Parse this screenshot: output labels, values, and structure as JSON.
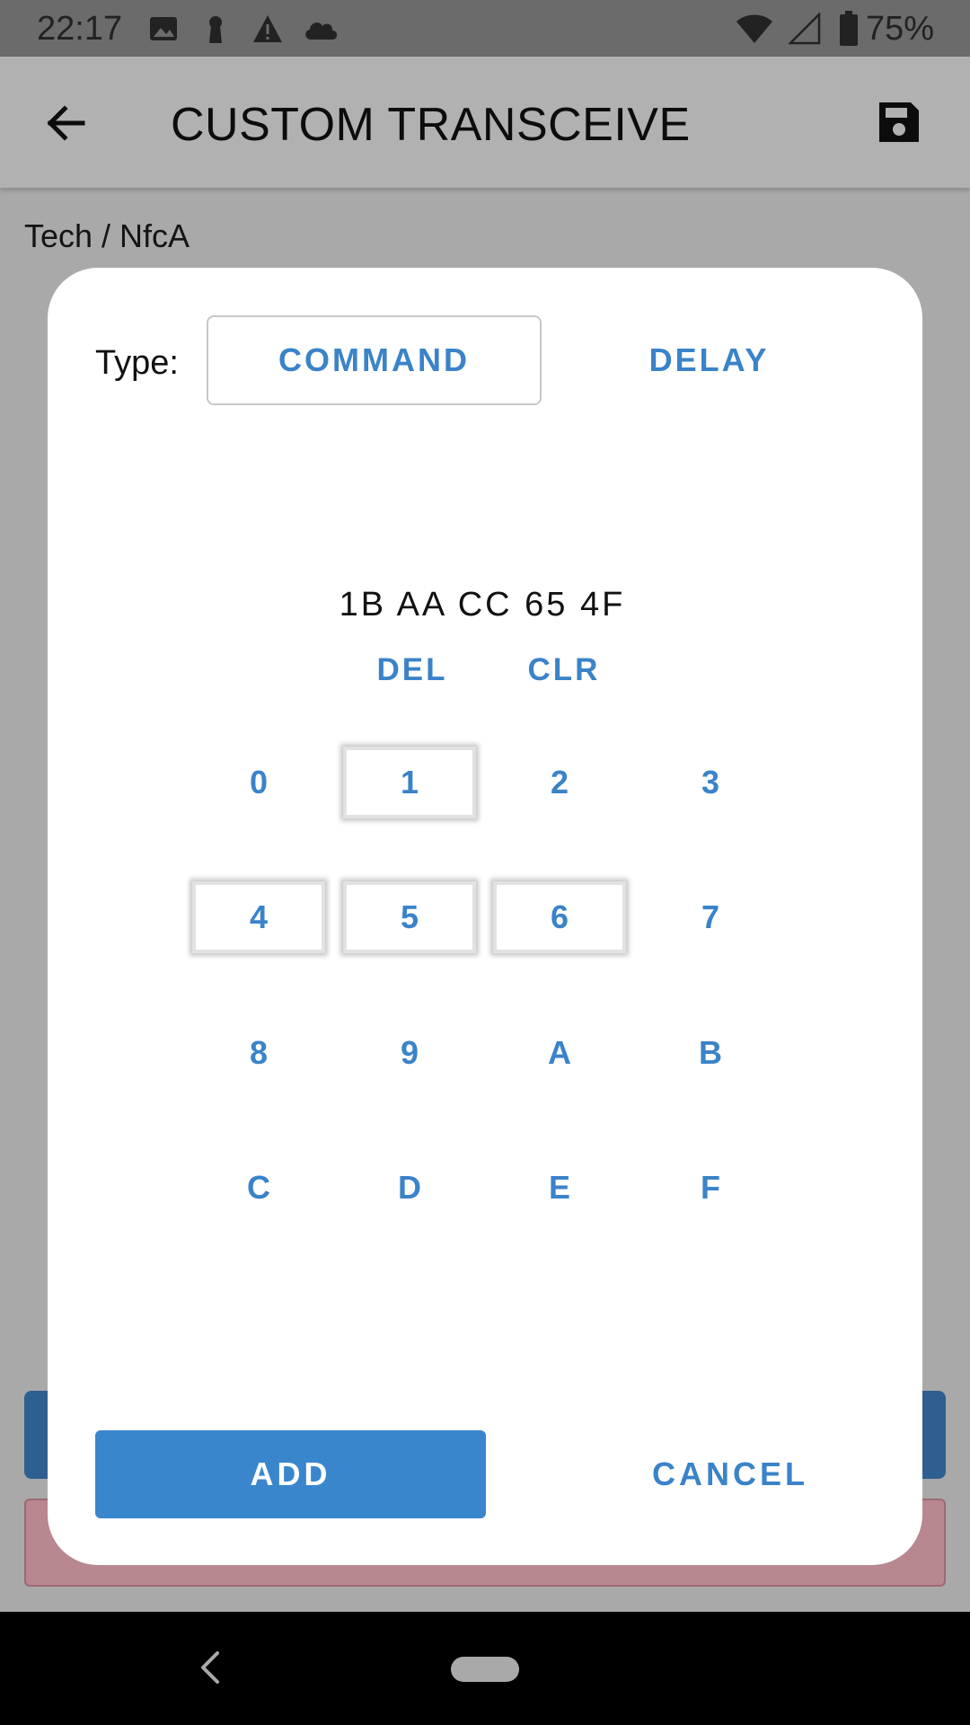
{
  "status_bar": {
    "time": "22:17",
    "battery_percent": "75%",
    "icons": [
      "image-icon",
      "keyhole-icon",
      "warning-icon",
      "cloud-icon",
      "wifi-icon",
      "cellular-signal-icon",
      "battery-icon"
    ]
  },
  "app_bar": {
    "title": "CUSTOM TRANSCEIVE",
    "back_icon": "back-arrow-icon",
    "save_icon": "save-icon"
  },
  "content": {
    "breadcrumb": "Tech / NfcA"
  },
  "dialog": {
    "type_label": "Type:",
    "type_options": [
      {
        "label": "COMMAND",
        "selected": true
      },
      {
        "label": "DELAY",
        "selected": false
      }
    ],
    "hex_value": "1B AA CC 65 4F",
    "del_label": "DEL",
    "clr_label": "CLR",
    "keypad": [
      "0",
      "1",
      "2",
      "3",
      "4",
      "5",
      "6",
      "7",
      "8",
      "9",
      "A",
      "B",
      "C",
      "D",
      "E",
      "F"
    ],
    "pressed_keys": [
      "1",
      "4",
      "5",
      "6"
    ],
    "add_label": "ADD",
    "cancel_label": "CANCEL"
  },
  "colors": {
    "accent": "#3a83c9",
    "add_button_bg": "#3a86cd",
    "scrim_bg": "#a9a9a9"
  }
}
